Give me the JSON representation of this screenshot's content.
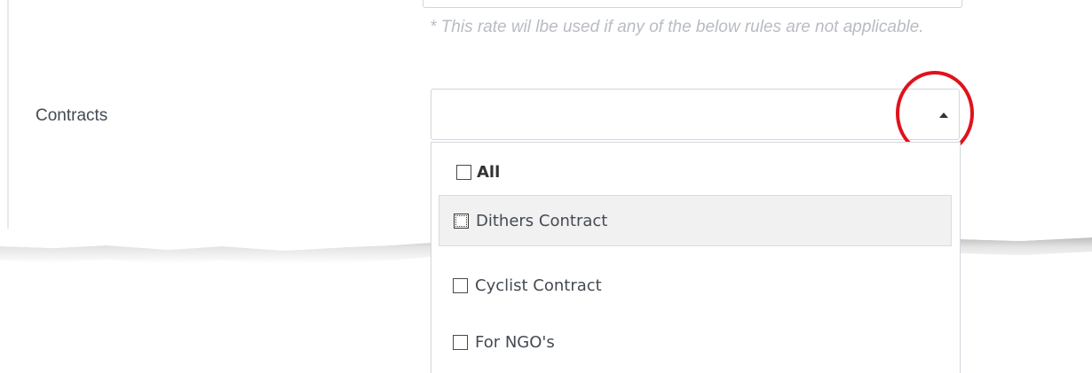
{
  "hint_text": "* This rate wil lbe used if any of the below rules are not applicable.",
  "contracts": {
    "label": "Contracts",
    "selected_value": "",
    "options": [
      {
        "label": "All",
        "checked": false
      },
      {
        "label": "Dithers Contract",
        "checked": false
      },
      {
        "label": "Cyclist Contract",
        "checked": false
      },
      {
        "label": "For NGO's",
        "checked": false
      }
    ]
  },
  "colors": {
    "highlight_circle": "#e0121b",
    "hint_text": "#b8bcc2",
    "hover_row": "#f1f1f1"
  },
  "icons": {
    "dropdown_toggle": "caret-up-icon"
  }
}
